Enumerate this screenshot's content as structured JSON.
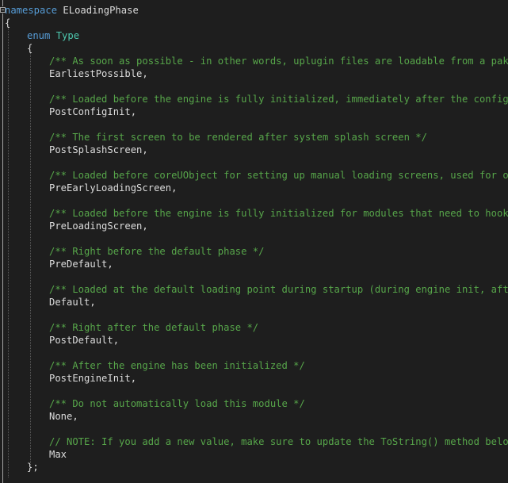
{
  "code": {
    "namespace_keyword": "namespace",
    "namespace_name": "ELoadingPhase",
    "open_brace": "{",
    "enum_keyword": "enum",
    "enum_name": "Type",
    "enum_open_brace": "{",
    "enum_close": "};",
    "entries": [
      {
        "comment": "/** As soon as possible - in other words, uplugin files are loadable from a pak fil",
        "value": "EarliestPossible,"
      },
      {
        "comment": "/** Loaded before the engine is fully initialized, immediately after the config sys",
        "value": "PostConfigInit,"
      },
      {
        "comment": "/** The first screen to be rendered after system splash screen */",
        "value": "PostSplashScreen,"
      },
      {
        "comment": "/** Loaded before coreUObject for setting up manual loading screens, used for our c",
        "value": "PreEarlyLoadingScreen,"
      },
      {
        "comment": "/** Loaded before the engine is fully initialized for modules that need to hook int",
        "value": "PreLoadingScreen,"
      },
      {
        "comment": "/** Right before the default phase */",
        "value": "PreDefault,"
      },
      {
        "comment": "/** Loaded at the default loading point during startup (during engine init, after g",
        "value": "Default,"
      },
      {
        "comment": "/** Right after the default phase */",
        "value": "PostDefault,"
      },
      {
        "comment": "/** After the engine has been initialized */",
        "value": "PostEngineInit,"
      },
      {
        "comment": "/** Do not automatically load this module */",
        "value": "None,"
      },
      {
        "comment": "// NOTE: If you add a new value, make sure to update the ToString() method below!",
        "value": "Max"
      }
    ]
  }
}
